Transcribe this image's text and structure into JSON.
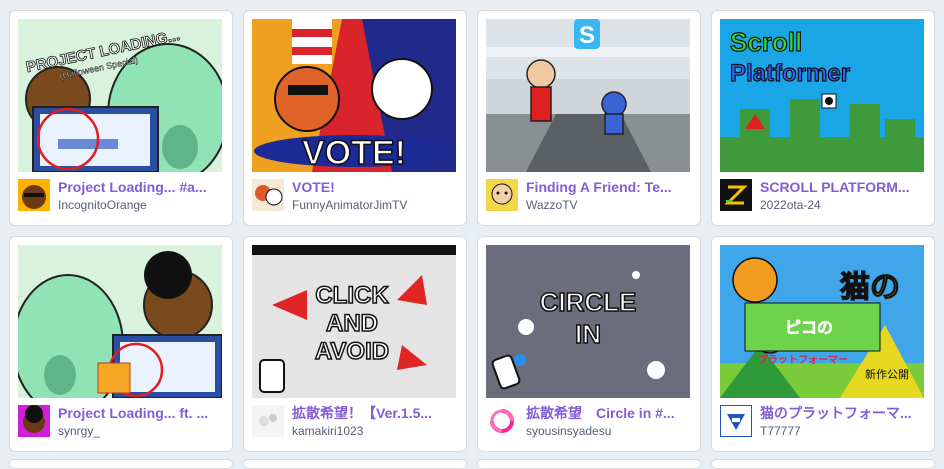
{
  "projects": [
    {
      "title": "Project Loading... #a...",
      "author": "IncognitoOrange",
      "thumb_text": "PROJECT LOADING...",
      "thumb_sub": "(Halloween Special)"
    },
    {
      "title": "VOTE!",
      "author": "FunnyAnimatorJimTV",
      "thumb_text": "VOTE!"
    },
    {
      "title": "Finding A Friend: Te...",
      "author": "WazzoTV"
    },
    {
      "title": "SCROLL PLATFORM...",
      "author": "2022ota-24",
      "thumb_text_1": "Scroll",
      "thumb_text_2": "Platformer"
    },
    {
      "title": "Project Loading... ft. ...",
      "author": "synrgy_"
    },
    {
      "title": "拡散希望！【Ver.1.5...",
      "author": "kamakiri1023",
      "thumb_text_1": "CLICK",
      "thumb_text_2": "AND",
      "thumb_text_3": "AVOID"
    },
    {
      "title": "拡散希望　Circle in #...",
      "author": "syousinsyadesu",
      "thumb_text_1": "CIRCLE",
      "thumb_text_2": "IN"
    },
    {
      "title": "猫のプラットフォーマ...",
      "author": "T77777",
      "thumb_text_1": "猫の",
      "thumb_text_2": "ピコの",
      "thumb_text_3": "プラットフォーマー",
      "thumb_text_4": "新作公開"
    }
  ],
  "colors": {
    "title": "#855cd6",
    "author": "#575e75",
    "background": "#e9eef2"
  }
}
